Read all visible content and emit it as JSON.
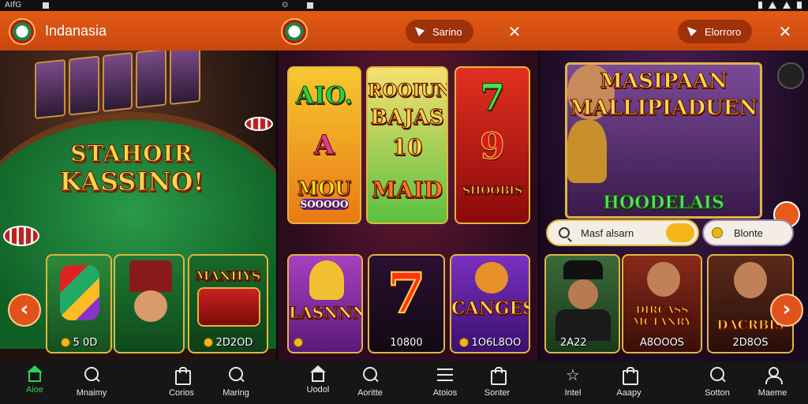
{
  "status_bar": {
    "left_text": "AIfG",
    "center_glyph": "⊙"
  },
  "app_bar": {
    "title": "Indanasia",
    "pill_left": "Sarino",
    "pill_right": "Elorroro",
    "close_glyph": "✕"
  },
  "panel1": {
    "banner_line1": "STAHOIR",
    "banner_line2": "KASSINO!",
    "card1_caption": "5 0D",
    "card3_title": "MANHYS",
    "card3_caption": "2D2OD",
    "arrow_left": "‹"
  },
  "panel2": {
    "slot1": {
      "title": "AIO.",
      "mid": "A",
      "bottom": "MOU",
      "sub": "SOOOOO"
    },
    "slot2": {
      "title": "ROOIUNO",
      "line2": "BAJAS",
      "line3": "10",
      "bottom": "MAID"
    },
    "slot3": {
      "title": "7",
      "mid": "9",
      "bottom": "SHOOBIS"
    },
    "card1": {
      "title": "LASNNN"
    },
    "card2": {
      "title": "7",
      "caption": "10800"
    },
    "card3": {
      "title": "CANGES",
      "caption": "1O6L8OO"
    }
  },
  "panel3": {
    "hero_line1": "MASIPAAN",
    "hero_line2": "MALLIPIADUEN",
    "hero_line3": "HOODELAIS",
    "search_text": "Masf alsarn",
    "chip_text": "Blonte",
    "card1_caption": "2A22",
    "card2_title": "DIRCASS MCTANRY",
    "card2_caption": "A8OOOS",
    "card3_title": "DACRBIS",
    "card3_caption": "2D8OS",
    "arrow_right": "›"
  },
  "bottom_nav": [
    {
      "label": "Aioe",
      "icon": "home-icon",
      "active": true
    },
    {
      "label": "Mnaimy",
      "icon": "search-icon",
      "active": false
    },
    {
      "label": "Corios",
      "icon": "bag-icon",
      "active": false
    },
    {
      "label": "Maring",
      "icon": "search-icon",
      "active": false
    },
    {
      "label": "Uodol",
      "icon": "home-icon",
      "active": false
    },
    {
      "label": "Aoritte",
      "icon": "search-icon",
      "active": false
    },
    {
      "label": "Atoios",
      "icon": "menu-icon",
      "active": false
    },
    {
      "label": "Sonter",
      "icon": "bag-icon",
      "active": false
    },
    {
      "label": "Intel",
      "icon": "star-icon",
      "active": false
    },
    {
      "label": "Aaapy",
      "icon": "bag-icon",
      "active": false
    },
    {
      "label": "Sotton",
      "icon": "search-icon",
      "active": false
    },
    {
      "label": "Maeme",
      "icon": "user-icon",
      "active": false
    }
  ],
  "colors": {
    "accent": "#e35a16",
    "active_nav": "#2fd05a",
    "gold": "#e1b640"
  }
}
